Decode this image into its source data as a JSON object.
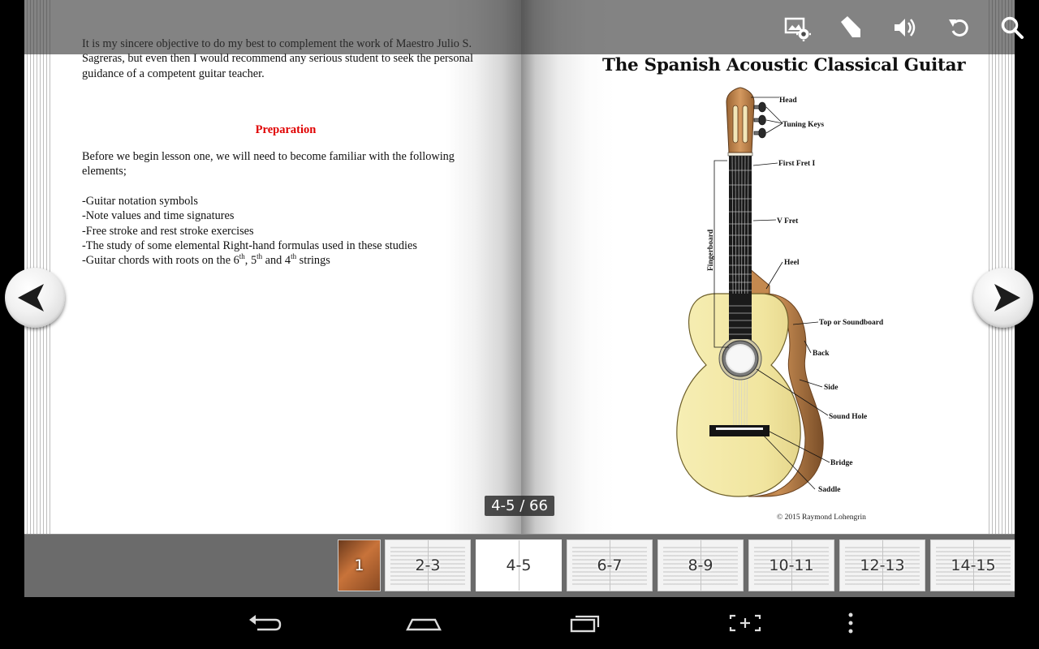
{
  "left_page": {
    "intro": "It is my sincere objective to do my best to complement the work of Maestro Julio S. Sagreras, but even then I would recommend any serious student to seek the personal guidance of a competent guitar teacher.",
    "heading": "Preparation",
    "before": "Before we begin lesson one, we will need to become familiar with the following elements;",
    "list": [
      "-Guitar notation symbols",
      "-Note values and time signatures",
      "-Free stroke and rest stroke exercises",
      "-The study of some elemental Right-hand formulas used in these studies"
    ],
    "chords_line": {
      "prefix": "-Guitar chords with roots on the 6",
      "sup1": "th",
      "mid1": ", 5",
      "sup2": "th",
      "mid2": " and 4",
      "sup3": "th",
      "suffix": " strings"
    }
  },
  "right_page": {
    "title": "The Spanish Acoustic  Classical Guitar",
    "labels": {
      "head": "Head",
      "tuning_keys": "Tuning Keys",
      "first_fret": "First Fret  I",
      "v_fret": "V Fret",
      "fingerboard": "Fingerboard",
      "heel": "Heel",
      "top": "Top or Soundboard",
      "back": "Back",
      "side": "Side",
      "sound_hole": "Sound Hole",
      "bridge": "Bridge",
      "saddle": "Saddle"
    },
    "copyright": "© 2015 Raymond Lohengrin"
  },
  "toolbar": {
    "icons": [
      "display-settings-icon",
      "bookmark-icon",
      "volume-icon",
      "rotate-icon",
      "search-icon"
    ]
  },
  "page_indicator": "4-5 / 66",
  "thumbnails": [
    "1",
    "2-3",
    "4-5",
    "6-7",
    "8-9",
    "10-11",
    "12-13",
    "14-15"
  ],
  "active_thumbnail": "4-5",
  "colors": {
    "heading_red": "#e00000",
    "guitar_top": "#f3e9a8",
    "guitar_side": "#b07a45",
    "toolbar_bg": "#373737"
  },
  "system_nav": [
    "back-icon",
    "home-icon",
    "recent-apps-icon",
    "screenshot-icon",
    "menu-icon"
  ]
}
